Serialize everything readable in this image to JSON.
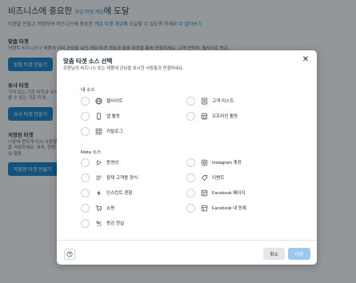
{
  "background": {
    "title_prefix": "비즈니스에 중요한 ",
    "title_link": "게임 타겟 게임",
    "title_suffix": "에 도달",
    "desc_prefix": "타겟을 만들고 저장하여 비즈니스에 중요한 ",
    "desc_link1": "게임 타겟 게임",
    "desc_mid": "에 도달할 수 있도록 하세요 ",
    "desc_link2": "더 알아보기",
    "sections": [
      {
        "title": "맞춤 타겟",
        "desc": "컨텐트 비즈니스나 제품에 이미 관심을 보인 게임 타겟 게임과 맞춤 타겟을 통해 연결하세요. 고객 연락처, 웹사이트 방문...",
        "button": "맞춤 타겟 만들기"
      },
      {
        "title": "유사 타겟",
        "desc": "가치 있는 기존 타겟과 유사한 사람들을 찾을 수 있는 기존 타겟...",
        "button": "유사 타겟 만들기"
      },
      {
        "title": "저장된 타겟",
        "desc": "나중에 편하게 다시 사용할 수 있도록 타겟을 저장하세요. 위치, 연령 등 특정 관심사 및 행동...",
        "button": "저장된 타겟 만들기"
      }
    ]
  },
  "modal": {
    "title": "맞춤 타겟 소스 선택",
    "subtitle": "회원님의 비즈니스 또는 제품에 관심을 표시한 사람들과 연결하세요.",
    "close_icon": "close-icon",
    "sections": {
      "our_sources": "내 소스",
      "meta_sources": "Meta 소스"
    },
    "our_options": [
      {
        "label": "웹사이트",
        "icon": "globe-icon"
      },
      {
        "label": "고객 리스트",
        "icon": "customer-list-icon"
      },
      {
        "label": "앱 활동",
        "icon": "mobile-app-icon"
      },
      {
        "label": "오프라인 활동",
        "icon": "offline-store-icon"
      },
      {
        "label": "카탈로그",
        "icon": "catalog-icon"
      }
    ],
    "meta_options": [
      {
        "label": "동영상",
        "icon": "play-icon"
      },
      {
        "label": "Instagram 계정",
        "icon": "instagram-icon"
      },
      {
        "label": "잠재 고객용 양식",
        "icon": "lead-form-icon"
      },
      {
        "label": "이벤트",
        "icon": "event-tag-icon"
      },
      {
        "label": "인스턴트 경험",
        "icon": "lightning-icon"
      },
      {
        "label": "Facebook 페이지",
        "icon": "facebook-page-icon"
      },
      {
        "label": "쇼핑",
        "icon": "shopping-cart-icon"
      },
      {
        "label": "Facebook 내 등록",
        "icon": "listing-icon"
      },
      {
        "label": "증강 현실",
        "icon": "ar-icon"
      }
    ],
    "footer": {
      "help_icon": "help-icon",
      "cancel_label": "취소",
      "next_label": "다음"
    }
  },
  "colors": {
    "accent": "#0a78be",
    "next_disabled": "#9cc8ee",
    "overlay": "#1e2328"
  }
}
